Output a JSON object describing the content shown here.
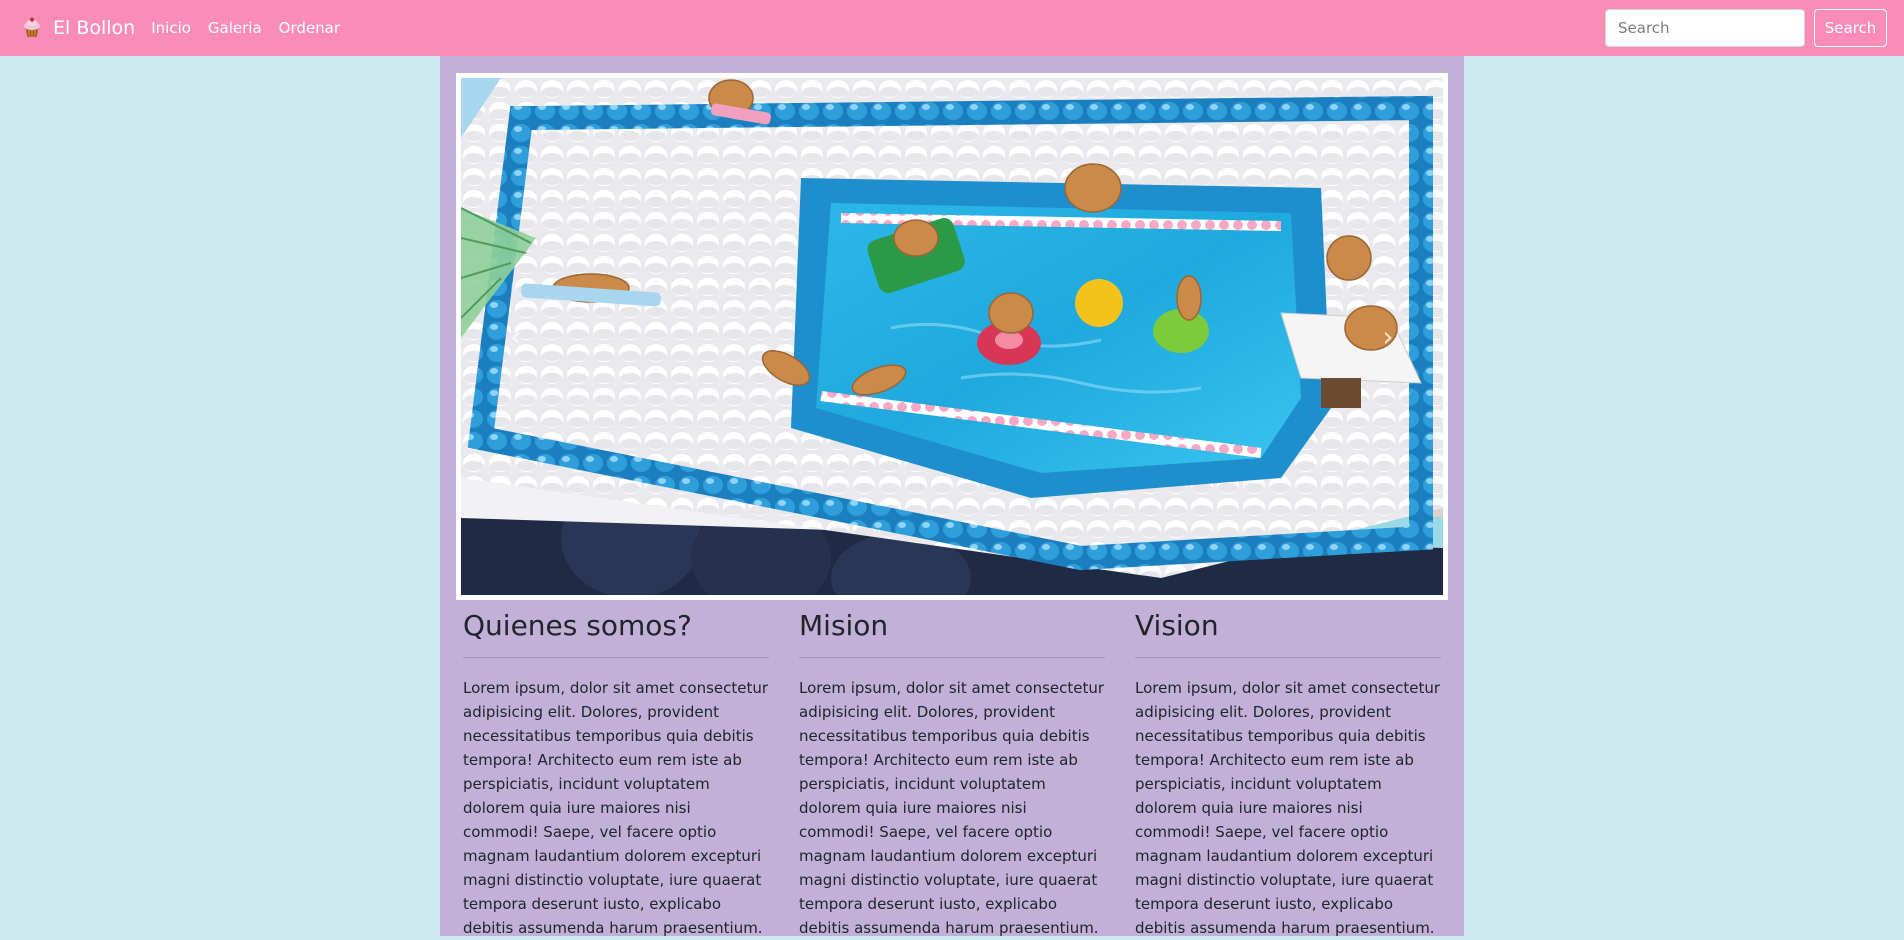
{
  "navbar": {
    "brand": "El Bollon",
    "brand_icon": "cupcake-icon",
    "links": [
      "Inicio",
      "Galeria",
      "Ordenar"
    ],
    "search_placeholder": "Search",
    "search_button": "Search"
  },
  "carousel": {
    "image": "pool-themed-cake-photo",
    "prev_icon": "chevron-left-icon",
    "next_icon": "chevron-right-icon"
  },
  "sections": [
    {
      "title": "Quienes somos?",
      "text": "Lorem ipsum, dolor sit amet consectetur adipisicing elit. Dolores, provident necessitatibus temporibus quia debitis tempora! Architecto eum rem iste ab perspiciatis, incidunt voluptatem dolorem quia iure maiores nisi commodi! Saepe, vel facere optio magnam laudantium dolorem excepturi magni distinctio voluptate, iure quaerat tempora deserunt iusto, explicabo debitis assumenda harum praesentium."
    },
    {
      "title": "Mision",
      "text": "Lorem ipsum, dolor sit amet consectetur adipisicing elit. Dolores, provident necessitatibus temporibus quia debitis tempora! Architecto eum rem iste ab perspiciatis, incidunt voluptatem dolorem quia iure maiores nisi commodi! Saepe, vel facere optio magnam laudantium dolorem excepturi magni distinctio voluptate, iure quaerat tempora deserunt iusto, explicabo debitis assumenda harum praesentium."
    },
    {
      "title": "Vision",
      "text": "Lorem ipsum, dolor sit amet consectetur adipisicing elit. Dolores, provident necessitatibus temporibus quia debitis tempora! Architecto eum rem iste ab perspiciatis, incidunt voluptatem dolorem quia iure maiores nisi commodi! Saepe, vel facere optio magnam laudantium dolorem excepturi magni distinctio voluptate, iure quaerat tempora deserunt iusto, explicabo debitis assumenda harum praesentium."
    }
  ],
  "colors": {
    "navbar": "#f98db8",
    "page_background": "#cdebef",
    "container_background": "#c2b0d8"
  }
}
